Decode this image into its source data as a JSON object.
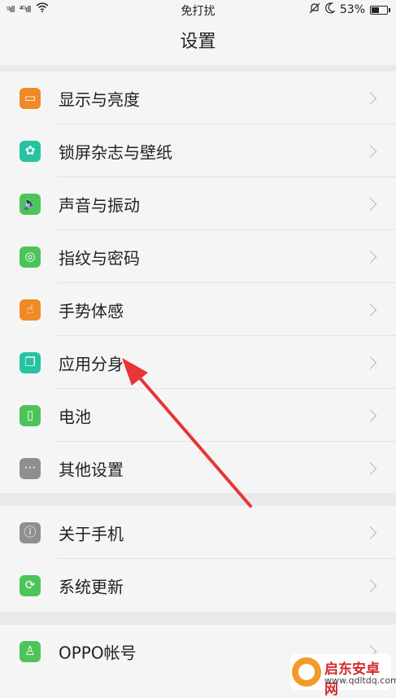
{
  "status_bar": {
    "signal1": "ᵍıll",
    "signal2": "⁴ᴳıll",
    "mode": "免打扰",
    "battery": "53%",
    "battery_level": 0.53
  },
  "header": {
    "title": "设置"
  },
  "groups": [
    {
      "items": [
        {
          "label": "显示与亮度",
          "icon": "display-icon",
          "color": "#f08a24",
          "glyph": "▭"
        },
        {
          "label": "锁屏杂志与壁纸",
          "icon": "wallpaper-flower-icon",
          "color": "#27c3a1",
          "glyph": "✿"
        },
        {
          "label": "声音与振动",
          "icon": "speaker-icon",
          "color": "#4cc45a",
          "glyph": "🔈"
        },
        {
          "label": "指纹与密码",
          "icon": "fingerprint-icon",
          "color": "#4cc45a",
          "glyph": "◎"
        },
        {
          "label": "手势体感",
          "icon": "gesture-hand-icon",
          "color": "#f08a24",
          "glyph": "☝"
        },
        {
          "label": "应用分身",
          "icon": "app-clone-icon",
          "color": "#27c3a1",
          "glyph": "❐"
        },
        {
          "label": "电池",
          "icon": "battery-icon",
          "color": "#4cc45a",
          "glyph": "▯"
        },
        {
          "label": "其他设置",
          "icon": "more-dots-icon",
          "color": "#8f8f8f",
          "glyph": "···"
        }
      ]
    },
    {
      "items": [
        {
          "label": "关于手机",
          "icon": "info-icon",
          "color": "#8f8f8f",
          "glyph": "ⓘ"
        },
        {
          "label": "系统更新",
          "icon": "update-icon",
          "color": "#4cc45a",
          "glyph": "⟳"
        }
      ]
    },
    {
      "items": [
        {
          "label": "OPPO帐号",
          "icon": "account-icon",
          "color": "#4cc45a",
          "glyph": "♙"
        }
      ]
    }
  ],
  "watermark": {
    "title": "启东安卓网",
    "url": "www.qdltdq.com"
  }
}
